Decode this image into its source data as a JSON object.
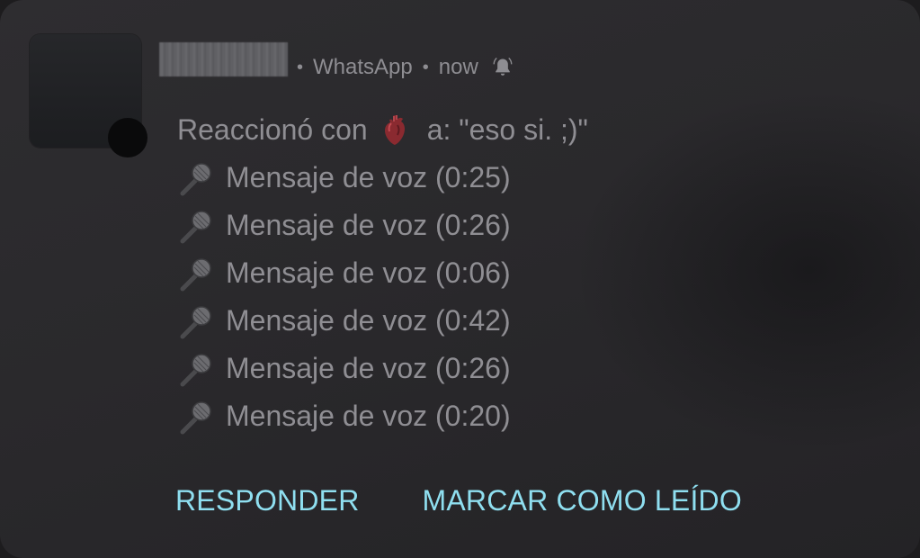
{
  "notification": {
    "app_name": "WhatsApp",
    "time": "now",
    "separator": "•",
    "icons": {
      "avatar": "contact-avatar",
      "app_badge": "app-badge",
      "bell": "bell-ringing-icon",
      "reaction": "anatomical-heart-emoji",
      "voice": "microphone-emoji"
    },
    "reaction": {
      "prefix": "Reaccionó con",
      "suffix": "a: \"eso si. ;)\""
    },
    "voice_messages": [
      "Mensaje de voz (0:25)",
      "Mensaje de voz (0:26)",
      "Mensaje de voz (0:06)",
      "Mensaje de voz (0:42)",
      "Mensaje de voz (0:26)",
      "Mensaje de voz (0:20)"
    ],
    "actions": {
      "reply": "RESPONDER",
      "mark_read": "MARCAR COMO LEÍDO"
    }
  },
  "colors": {
    "background": "#2b2a2d",
    "text": "#8f8e93",
    "action": "#8fdff0"
  }
}
